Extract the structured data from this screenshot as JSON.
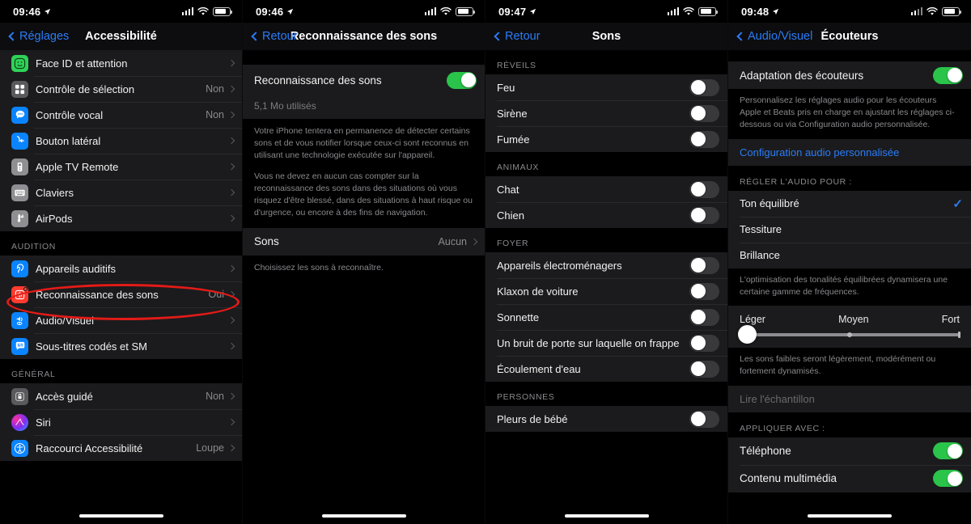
{
  "screens": [
    {
      "id": "accessibilite",
      "statusbar": {
        "time": "09:46",
        "location_icon": "location-arrow-icon",
        "signal_icon": "cellular-bars-icon",
        "wifi_icon": "wifi-icon",
        "battery_icon": "battery-icon"
      },
      "nav": {
        "back_label": "Réglages",
        "title": "Accessibilité"
      },
      "groups": [
        {
          "header": "",
          "rows": [
            {
              "icon": "face-id-icon",
              "label": "Face ID et attention",
              "value": "",
              "accessory": "chevron"
            },
            {
              "icon": "switch-control-icon",
              "label": "Contrôle de sélection",
              "value": "Non",
              "accessory": "chevron"
            },
            {
              "icon": "voice-control-icon",
              "label": "Contrôle vocal",
              "value": "Non",
              "accessory": "chevron"
            },
            {
              "icon": "side-button-icon",
              "label": "Bouton latéral",
              "value": "",
              "accessory": "chevron"
            },
            {
              "icon": "apple-tv-remote-icon",
              "label": "Apple TV Remote",
              "value": "",
              "accessory": "chevron"
            },
            {
              "icon": "keyboard-icon",
              "label": "Claviers",
              "value": "",
              "accessory": "chevron"
            },
            {
              "icon": "airpods-icon",
              "label": "AirPods",
              "value": "",
              "accessory": "chevron"
            }
          ]
        },
        {
          "header": "AUDITION",
          "rows": [
            {
              "icon": "hearing-devices-icon",
              "label": "Appareils auditifs",
              "value": "",
              "accessory": "chevron"
            },
            {
              "icon": "sound-recognition-icon",
              "label": "Reconnaissance des sons",
              "value": "Oui",
              "accessory": "chevron",
              "highlighted": true
            },
            {
              "icon": "audio-visual-icon",
              "label": "Audio/Visuel",
              "value": "",
              "accessory": "chevron"
            },
            {
              "icon": "subtitles-icon",
              "label": "Sous-titres codés et SM",
              "value": "",
              "accessory": "chevron"
            }
          ]
        },
        {
          "header": "GÉNÉRAL",
          "rows": [
            {
              "icon": "guided-access-icon",
              "label": "Accès guidé",
              "value": "Non",
              "accessory": "chevron"
            },
            {
              "icon": "siri-icon",
              "label": "Siri",
              "value": "",
              "accessory": "chevron"
            },
            {
              "icon": "accessibility-shortcut-icon",
              "label": "Raccourci Accessibilité",
              "value": "Loupe",
              "accessory": "chevron"
            }
          ]
        }
      ]
    },
    {
      "id": "reconnaissance-des-sons",
      "statusbar": {
        "time": "09:46"
      },
      "nav": {
        "back_label": "Retour",
        "title": "Reconnaissance des sons"
      },
      "toggle_row": {
        "label": "Reconnaissance des sons",
        "state": "on"
      },
      "storage_note": "5,1 Mo utilisés",
      "footnotes": [
        "Votre iPhone tentera en permanence de détecter certains sons et de vous notifier lorsque ceux-ci sont reconnus en utilisant une technologie exécutée sur l'appareil.",
        "Vous ne devez en aucun cas compter sur la reconnaissance des sons dans des situations où vous risquez d'être blessé, dans des situations à haut risque ou d'urgence, ou encore à des fins de navigation."
      ],
      "sounds_row": {
        "label": "Sons",
        "value": "Aucun"
      },
      "sounds_footnote": "Choisissez les sons à reconnaître."
    },
    {
      "id": "sons",
      "statusbar": {
        "time": "09:47"
      },
      "nav": {
        "back_label": "Retour",
        "title": "Sons"
      },
      "groups": [
        {
          "header": "RÉVEILS",
          "rows": [
            {
              "label": "Feu",
              "state": "off"
            },
            {
              "label": "Sirène",
              "state": "off"
            },
            {
              "label": "Fumée",
              "state": "off"
            }
          ]
        },
        {
          "header": "ANIMAUX",
          "rows": [
            {
              "label": "Chat",
              "state": "off"
            },
            {
              "label": "Chien",
              "state": "off"
            }
          ]
        },
        {
          "header": "FOYER",
          "rows": [
            {
              "label": "Appareils électroménagers",
              "state": "off"
            },
            {
              "label": "Klaxon de voiture",
              "state": "off"
            },
            {
              "label": "Sonnette",
              "state": "off"
            },
            {
              "label": "Un bruit de porte sur laquelle on frappe",
              "state": "off"
            },
            {
              "label": "Écoulement d'eau",
              "state": "off"
            }
          ]
        },
        {
          "header": "PERSONNES",
          "rows": [
            {
              "label": "Pleurs de bébé",
              "state": "off"
            }
          ]
        }
      ]
    },
    {
      "id": "ecouteurs",
      "statusbar": {
        "time": "09:48"
      },
      "nav": {
        "back_label": "Audio/Visuel",
        "title": "Écouteurs"
      },
      "adaptation_row": {
        "label": "Adaptation des écouteurs",
        "state": "on"
      },
      "adaptation_footnote": "Personnalisez les réglages audio pour les écouteurs Apple et Beats pris en charge en ajustant les réglages ci-dessous ou via Configuration audio personnalisée.",
      "custom_audio_link": "Configuration audio personnalisée",
      "tune_header": "RÉGLER L'AUDIO POUR :",
      "tune_options": [
        {
          "label": "Ton équilibré",
          "selected": true
        },
        {
          "label": "Tessiture",
          "selected": false
        },
        {
          "label": "Brillance",
          "selected": false
        }
      ],
      "tune_footnote": "L'optimisation des tonalités équilibrées dynamisera une certaine gamme de fréquences.",
      "slider": {
        "left_label": "Léger",
        "mid_label": "Moyen",
        "right_label": "Fort",
        "value_percent": 0
      },
      "slider_footnote": "Les sons faibles seront légèrement, modérément ou fortement dynamisés.",
      "play_sample": "Lire l'échantillon",
      "apply_header": "APPLIQUER AVEC :",
      "apply_rows": [
        {
          "label": "Téléphone",
          "state": "on"
        },
        {
          "label": "Contenu multimédia",
          "state": "on"
        }
      ]
    }
  ],
  "colors": {
    "accent_blue": "#2b7cf6",
    "toggle_on": "#2ac44a",
    "annotation_red": "#e31b17"
  }
}
